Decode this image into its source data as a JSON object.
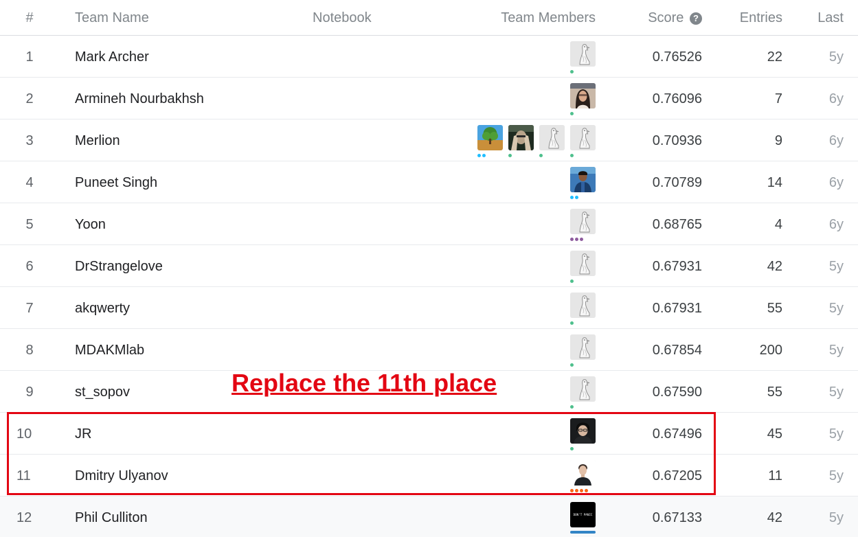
{
  "columns": {
    "rank": "#",
    "team_name": "Team Name",
    "notebook": "Notebook",
    "team_members": "Team Members",
    "score": "Score",
    "score_help_icon": "help-icon",
    "entries": "Entries",
    "last": "Last"
  },
  "rows": [
    {
      "rank": "1",
      "team": "Mark Archer",
      "score": "0.76526",
      "entries": "22",
      "last": "5y",
      "members": [
        {
          "avatar": "goose",
          "tier": "contributor",
          "tier_color": "#20beff"
        }
      ]
    },
    {
      "rank": "2",
      "team": "Armineh Nourbakhsh",
      "score": "0.76096",
      "entries": "7",
      "last": "6y",
      "members": [
        {
          "avatar": "photo-woman",
          "tier": "contributor",
          "tier_color": "#20beff"
        }
      ]
    },
    {
      "rank": "3",
      "team": "Merlion",
      "score": "0.70936",
      "entries": "9",
      "last": "6y",
      "members": [
        {
          "avatar": "goose",
          "tier": "contributor",
          "tier_color": "#20beff"
        },
        {
          "avatar": "goose",
          "tier": "contributor",
          "tier_color": "#20beff"
        },
        {
          "avatar": "photo-hands",
          "tier": "contributor",
          "tier_color": "#20beff"
        },
        {
          "avatar": "photo-tree",
          "tier": "expert",
          "tier_color": "#20beff"
        }
      ]
    },
    {
      "rank": "4",
      "team": "Puneet Singh",
      "score": "0.70789",
      "entries": "14",
      "last": "6y",
      "members": [
        {
          "avatar": "photo-man-blue",
          "tier": "expert",
          "tier_color": "#20beff"
        }
      ]
    },
    {
      "rank": "5",
      "team": "Yoon",
      "score": "0.68765",
      "entries": "4",
      "last": "6y",
      "members": [
        {
          "avatar": "goose",
          "tier": "master",
          "tier_color": "#8e5b9e"
        }
      ]
    },
    {
      "rank": "6",
      "team": "DrStrangelove",
      "score": "0.67931",
      "entries": "42",
      "last": "5y",
      "members": [
        {
          "avatar": "goose",
          "tier": "contributor",
          "tier_color": "#20beff"
        }
      ]
    },
    {
      "rank": "7",
      "team": "akqwerty",
      "score": "0.67931",
      "entries": "55",
      "last": "5y",
      "members": [
        {
          "avatar": "goose",
          "tier": "contributor",
          "tier_color": "#20beff"
        }
      ]
    },
    {
      "rank": "8",
      "team": "MDAKMlab",
      "score": "0.67854",
      "entries": "200",
      "last": "5y",
      "members": [
        {
          "avatar": "goose",
          "tier": "contributor",
          "tier_color": "#20beff"
        }
      ]
    },
    {
      "rank": "9",
      "team": "st_sopov",
      "score": "0.67590",
      "entries": "55",
      "last": "5y",
      "members": [
        {
          "avatar": "goose",
          "tier": "contributor",
          "tier_color": "#20beff"
        }
      ]
    },
    {
      "rank": "10",
      "team": "JR",
      "score": "0.67496",
      "entries": "45",
      "last": "5y",
      "members": [
        {
          "avatar": "photo-man-dark",
          "tier": "contributor",
          "tier_color": "#20beff"
        }
      ]
    },
    {
      "rank": "11",
      "team": "Dmitry Ulyanov",
      "score": "0.67205",
      "entries": "11",
      "last": "5y",
      "members": [
        {
          "avatar": "photo-man-white",
          "tier": "grandmaster",
          "tier_color": "#f96517"
        }
      ]
    },
    {
      "rank": "12",
      "team": "Phil Culliton",
      "score": "0.67133",
      "entries": "42",
      "last": "5y",
      "members": [
        {
          "avatar": "photo-dont-panic",
          "tier": "staff",
          "tier_color": "#3385c6"
        }
      ]
    }
  ],
  "annotation": {
    "text": "Replace the 11th place",
    "color": "#e30613"
  }
}
